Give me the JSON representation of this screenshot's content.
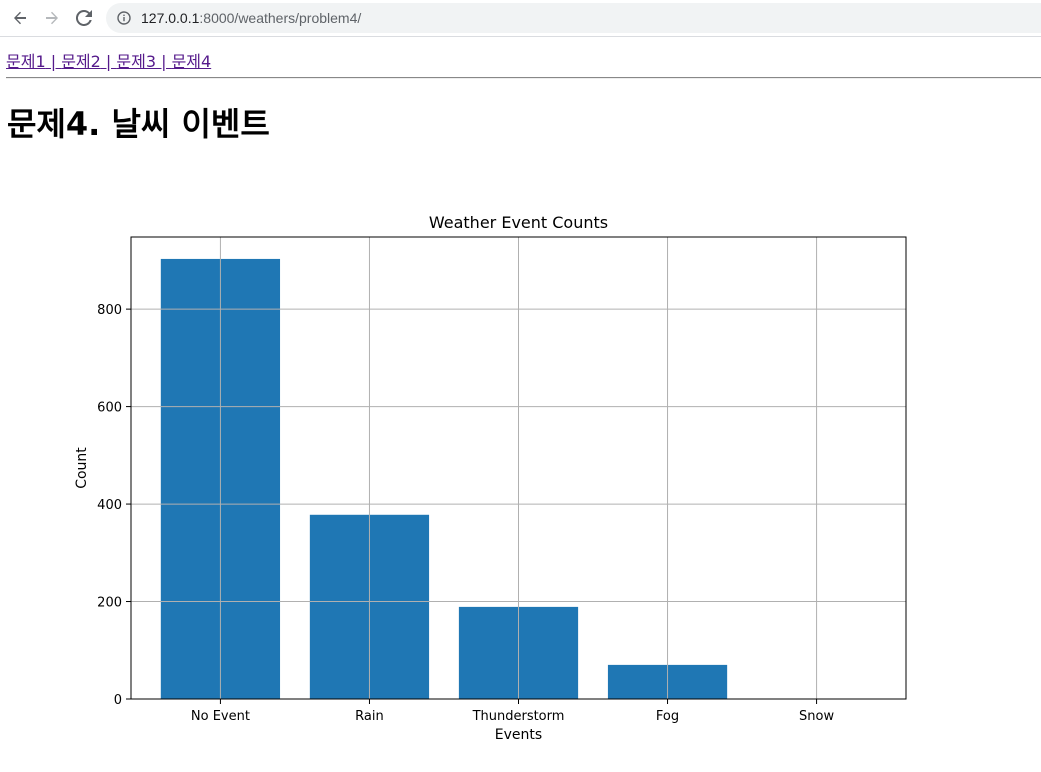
{
  "browser": {
    "url_host": "127.0.0.1",
    "url_rest": ":8000/weathers/problem4/"
  },
  "nav": {
    "links": [
      "문제1",
      "문제2",
      "문제3",
      "문제4"
    ],
    "separator": " | "
  },
  "page": {
    "title": "문제4. 날씨 이벤트"
  },
  "colors": {
    "bar": "#1f77b4",
    "grid": "#b0b0b0",
    "link": "#551a8b"
  },
  "chart_data": {
    "type": "bar",
    "title": "Weather Event Counts",
    "xlabel": "Events",
    "ylabel": "Count",
    "categories": [
      "No Event",
      "Rain",
      "Thunderstorm",
      "Fog",
      "Snow"
    ],
    "values": [
      903,
      378,
      189,
      70,
      1
    ],
    "ylim": [
      0,
      948
    ],
    "yticks": [
      0,
      200,
      400,
      600,
      800
    ],
    "grid": true
  }
}
